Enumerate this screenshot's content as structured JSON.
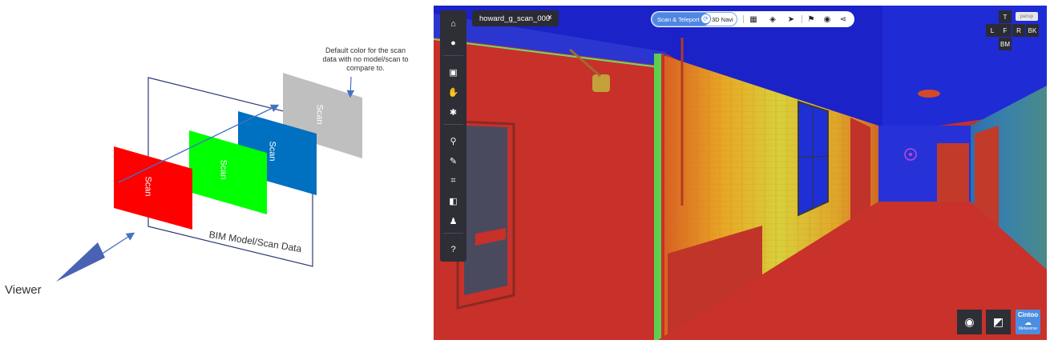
{
  "diagram": {
    "default_note": "Default color for the scan data with no model/scan to compare to.",
    "viewer_label": "Viewer",
    "bim_label": "BIM Model/Scan Data",
    "scan_labels": [
      "Scan",
      "Scan",
      "Scan",
      "Scan"
    ],
    "colors": {
      "red": "#ff0000",
      "green": "#00ff00",
      "blue": "#0070c0",
      "gray": "#bfbfbf",
      "arrow": "#4472c4"
    }
  },
  "viewer": {
    "scan_name": "howard_g_scan_000",
    "close_icon": "×",
    "mode": {
      "scan_teleport": "Scan & Teleport",
      "three_d_navi": "3D Navi",
      "knob_icon": "⟳"
    },
    "top_icons": [
      {
        "name": "grid-icon",
        "glyph": "▦"
      },
      {
        "name": "layers-icon",
        "glyph": "◈"
      },
      {
        "name": "pointer-icon",
        "glyph": "➤"
      },
      {
        "name": "flag-icon",
        "glyph": "⚑"
      },
      {
        "name": "camera-icon",
        "glyph": "◉"
      },
      {
        "name": "share-icon",
        "glyph": "⋖"
      }
    ],
    "sidebar_icons": [
      {
        "name": "home-icon",
        "glyph": "⌂"
      },
      {
        "name": "globe-icon",
        "glyph": "●"
      },
      {
        "name": "monitor-icon",
        "glyph": "▣"
      },
      {
        "name": "pan-icon",
        "glyph": "✋"
      },
      {
        "name": "settings-icon",
        "glyph": "✱"
      },
      {
        "name": "location-icon",
        "glyph": "⚲"
      },
      {
        "name": "ruler-icon",
        "glyph": "✎"
      },
      {
        "name": "crop-icon",
        "glyph": "⌗"
      },
      {
        "name": "compare-icon",
        "glyph": "◧"
      },
      {
        "name": "person-pin-icon",
        "glyph": "♟"
      },
      {
        "name": "help-icon",
        "glyph": "?"
      }
    ],
    "views": {
      "top": "T",
      "persp": "persp",
      "left": "L",
      "front": "F",
      "right": "R",
      "back": "BK",
      "bottom": "BM"
    },
    "bottom_right": {
      "icon1": "◉",
      "icon2": "◩"
    },
    "brand": {
      "name": "Cintoo",
      "cloud": "☁",
      "sub": "Metaverse"
    }
  }
}
